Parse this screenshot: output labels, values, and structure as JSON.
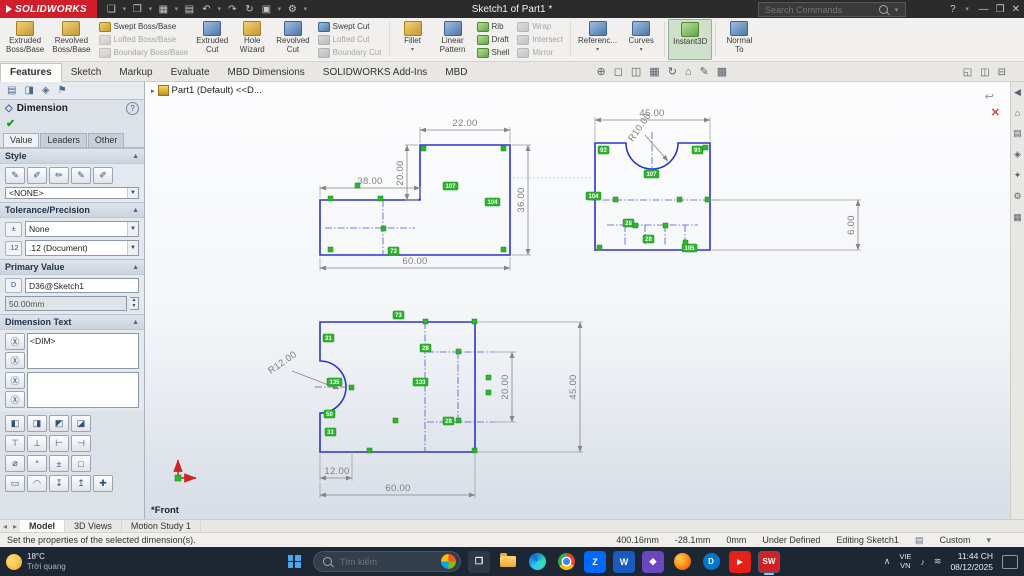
{
  "titlebar": {
    "logo": "SOLIDWORKS",
    "title": "Sketch1 of Part1 *",
    "search_placeholder": "Search Commands"
  },
  "ribbon": {
    "tabs": [
      "Features",
      "Sketch",
      "Markup",
      "Evaluate",
      "MBD Dimensions",
      "SOLIDWORKS Add-Ins",
      "MBD"
    ],
    "buttons": {
      "extruded_boss": "Extruded\nBoss/Base",
      "revolved_boss": "Revolved\nBoss/Base",
      "swept_boss": "Swept Boss/Base",
      "lofted_boss": "Lofted Boss/Base",
      "boundary_boss": "Boundary Boss/Base",
      "extruded_cut": "Extruded\nCut",
      "hole_wizard": "Hole\nWizard",
      "revolved_cut": "Revolved\nCut",
      "swept_cut": "Swept Cut",
      "lofted_cut": "Lofted Cut",
      "boundary_cut": "Boundary Cut",
      "fillet": "Fillet",
      "linear_pattern": "Linear\nPattern",
      "rib": "Rib",
      "draft": "Draft",
      "shell": "Shell",
      "wrap": "Wrap",
      "intersect": "Intersect",
      "mirror": "Mirror",
      "reference": "Referenc...",
      "curves": "Curves",
      "instant3d": "Instant3D",
      "normal_to": "Normal\nTo"
    }
  },
  "panel": {
    "title": "Dimension",
    "help": "?",
    "check": "✔",
    "tabs": [
      "Value",
      "Leaders",
      "Other"
    ],
    "style": {
      "header": "Style",
      "none": "<NONE>"
    },
    "tolerance": {
      "header": "Tolerance/Precision",
      "type": "None",
      "precision": ".12 (Document)"
    },
    "primary": {
      "header": "Primary Value",
      "name": "D36@Sketch1",
      "value": "50.00mm"
    },
    "dimtext": {
      "header": "Dimension Text",
      "token": "<DIM>"
    }
  },
  "viewport": {
    "tree_root": "Part1 (Default) <<D...",
    "front_label": "*Front"
  },
  "sketch": {
    "dims": {
      "v1_top": "22.00",
      "v1_left": "38.00",
      "v1_step": "20.00",
      "v1_height": "36.00",
      "v1_width": "60.00",
      "v2_width": "45.00",
      "v2_radius": "R10.00",
      "v2_offset": "6.00",
      "v3_radius": "R12.00",
      "v3_inner": "20.00",
      "v3_height": "45.00",
      "v3_left": "12.00",
      "v3_width": "60.00"
    },
    "markers": {
      "m1": "107",
      "m2": "104",
      "m3": "73",
      "m4": "92",
      "m5": "91",
      "m6": "107",
      "m7": "104",
      "m8": "28",
      "m9": "28",
      "m10": "105",
      "m11": "73",
      "m12": "31",
      "m13": "135",
      "m14": "50",
      "m15": "31",
      "m16": "133",
      "m17": "28",
      "m18": "28"
    }
  },
  "bottom_tabs": {
    "model": "Model",
    "views": "3D Views",
    "motion": "Motion Study 1"
  },
  "status": {
    "message": "Set the properties of the selected dimension(s).",
    "x": "400.16mm",
    "y": "-28.1mm",
    "z": "0mm",
    "state": "Under Defined",
    "editing": "Editing Sketch1",
    "custom": "Custom"
  },
  "taskbar": {
    "weather_temp": "18°C",
    "weather_desc": "Trời quang",
    "search_placeholder": "Tìm kiếm",
    "lang_top": "VIE",
    "lang_bottom": "VN",
    "time": "11:44 CH",
    "date": "08/12/2025",
    "app_glyphs": {
      "taskview": "❐",
      "zalo": "Z",
      "word": "W",
      "purple": "◆",
      "dell": "D",
      "youtube": "▶",
      "solidworks": "SW"
    }
  },
  "colors": {
    "brand_red": "#d01f2b",
    "sketch_blue": "#2a35cc",
    "relation_green": "#2db52d",
    "dim_gray": "#7f7f7f",
    "taskbar_bg": "#1d2633"
  }
}
